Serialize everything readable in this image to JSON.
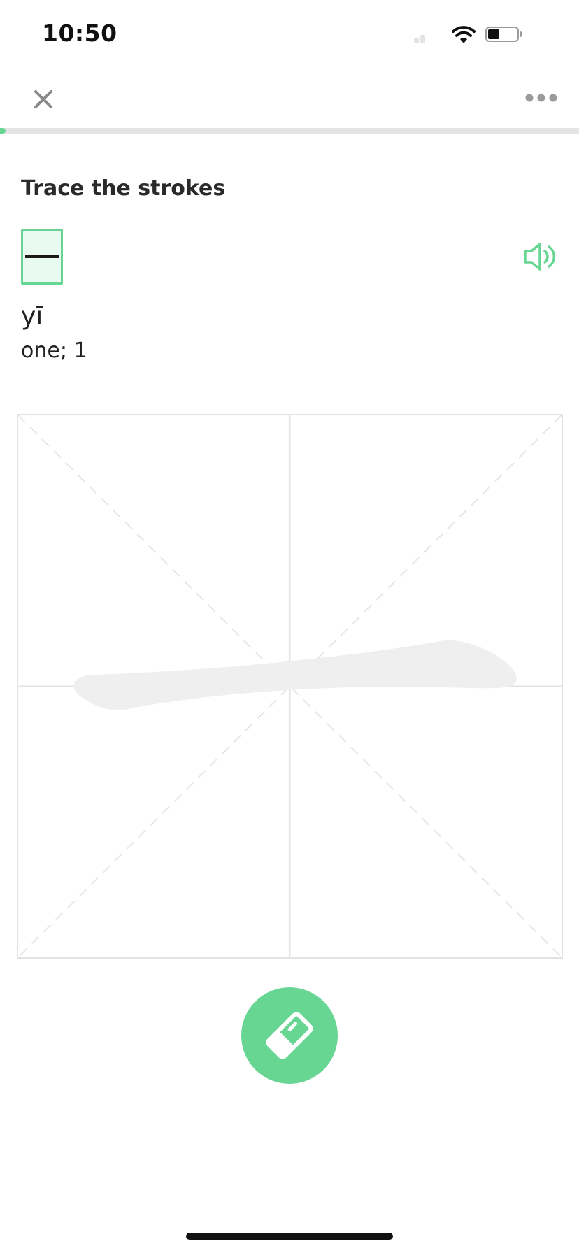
{
  "status_bar": {
    "time": "10:50",
    "battery_level": 0.4
  },
  "nav": {
    "close_icon": "close-icon",
    "more_icon": "ellipsis-icon"
  },
  "progress": {
    "value": 0.01
  },
  "exercise": {
    "instruction": "Trace the strokes",
    "character": "一",
    "pinyin": "yī",
    "meaning": "one; 1",
    "audio_icon": "speaker-icon"
  },
  "canvas": {
    "guide": "tian-zi-ge grid with diagonals",
    "stroke_hint_color": "#efefef"
  },
  "actions": {
    "erase_icon": "eraser-icon"
  },
  "colors": {
    "accent": "#66d692",
    "accent_light": "#e9fbf0",
    "grid": "#e3e3e3"
  }
}
